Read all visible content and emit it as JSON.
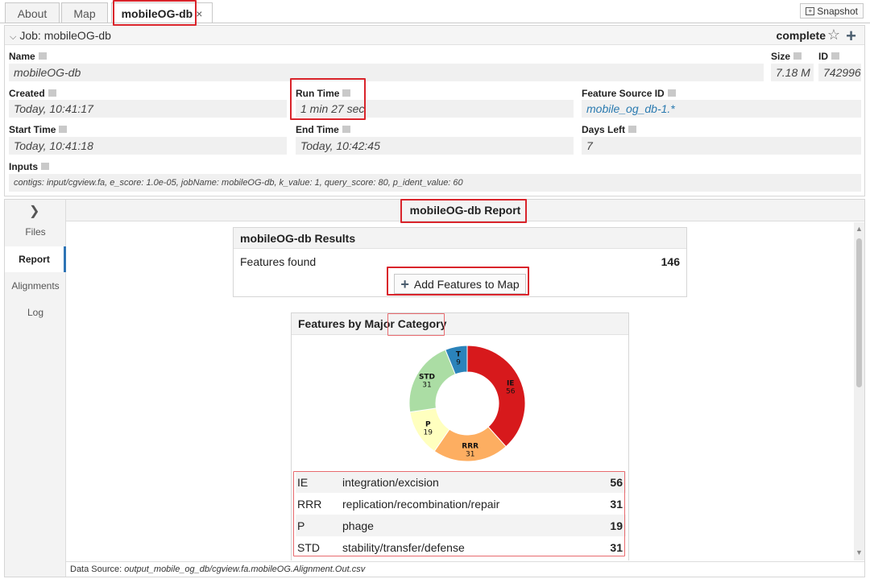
{
  "tabs": [
    {
      "label": "About"
    },
    {
      "label": "Map"
    },
    {
      "label": "mobileOG-db",
      "close": "×"
    }
  ],
  "snapshot_label": "Snapshot",
  "job": {
    "title": "Job: mobileOG-db",
    "status": "complete",
    "fields": {
      "name_label": "Name",
      "name": "mobileOG-db",
      "size_label": "Size",
      "size": "7.18 M",
      "id_label": "ID",
      "id": "742996",
      "created_label": "Created",
      "created": "Today, 10:41:17",
      "runtime_label": "Run Time",
      "runtime": "1 min 27 sec",
      "fsid_label": "Feature Source ID",
      "fsid": "mobile_og_db-1.*",
      "start_label": "Start Time",
      "start": "Today, 10:41:18",
      "end_label": "End Time",
      "end": "Today, 10:42:45",
      "days_label": "Days Left",
      "days": "7",
      "inputs_label": "Inputs",
      "inputs": "contigs: input/cgview.fa, e_score: 1.0e-05, jobName: mobileOG-db, k_value: 1, query_score: 80, p_ident_value: 60"
    }
  },
  "sidenav": {
    "items": [
      "Files",
      "Report",
      "Alignments",
      "Log"
    ],
    "active": "Report"
  },
  "report": {
    "title": "mobileOG-db Report",
    "results_title": "mobileOG-db Results",
    "features_label": "Features found",
    "features_count": "146",
    "add_button": "Add Features to Map",
    "category_title": "Features by Major Category"
  },
  "chart_data": {
    "type": "pie",
    "donut": true,
    "slices": [
      {
        "label": "IE",
        "value": 56,
        "color": "#d7191c"
      },
      {
        "label": "RRR",
        "value": 31,
        "color": "#fdae61"
      },
      {
        "label": "P",
        "value": 19,
        "color": "#ffffbf"
      },
      {
        "label": "STD",
        "value": 31,
        "color": "#abdda4"
      },
      {
        "label": "T",
        "value": 9,
        "color": "#2b83ba"
      }
    ]
  },
  "legend": [
    {
      "abbr": "IE",
      "name": "integration/excision",
      "count": "56"
    },
    {
      "abbr": "RRR",
      "name": "replication/recombination/repair",
      "count": "31"
    },
    {
      "abbr": "P",
      "name": "phage",
      "count": "19"
    },
    {
      "abbr": "STD",
      "name": "stability/transfer/defense",
      "count": "31"
    }
  ],
  "footer": {
    "label": "Data Source:",
    "source": "output_mobile_og_db/cgview.fa.mobileOG.Alignment.Out.csv"
  }
}
